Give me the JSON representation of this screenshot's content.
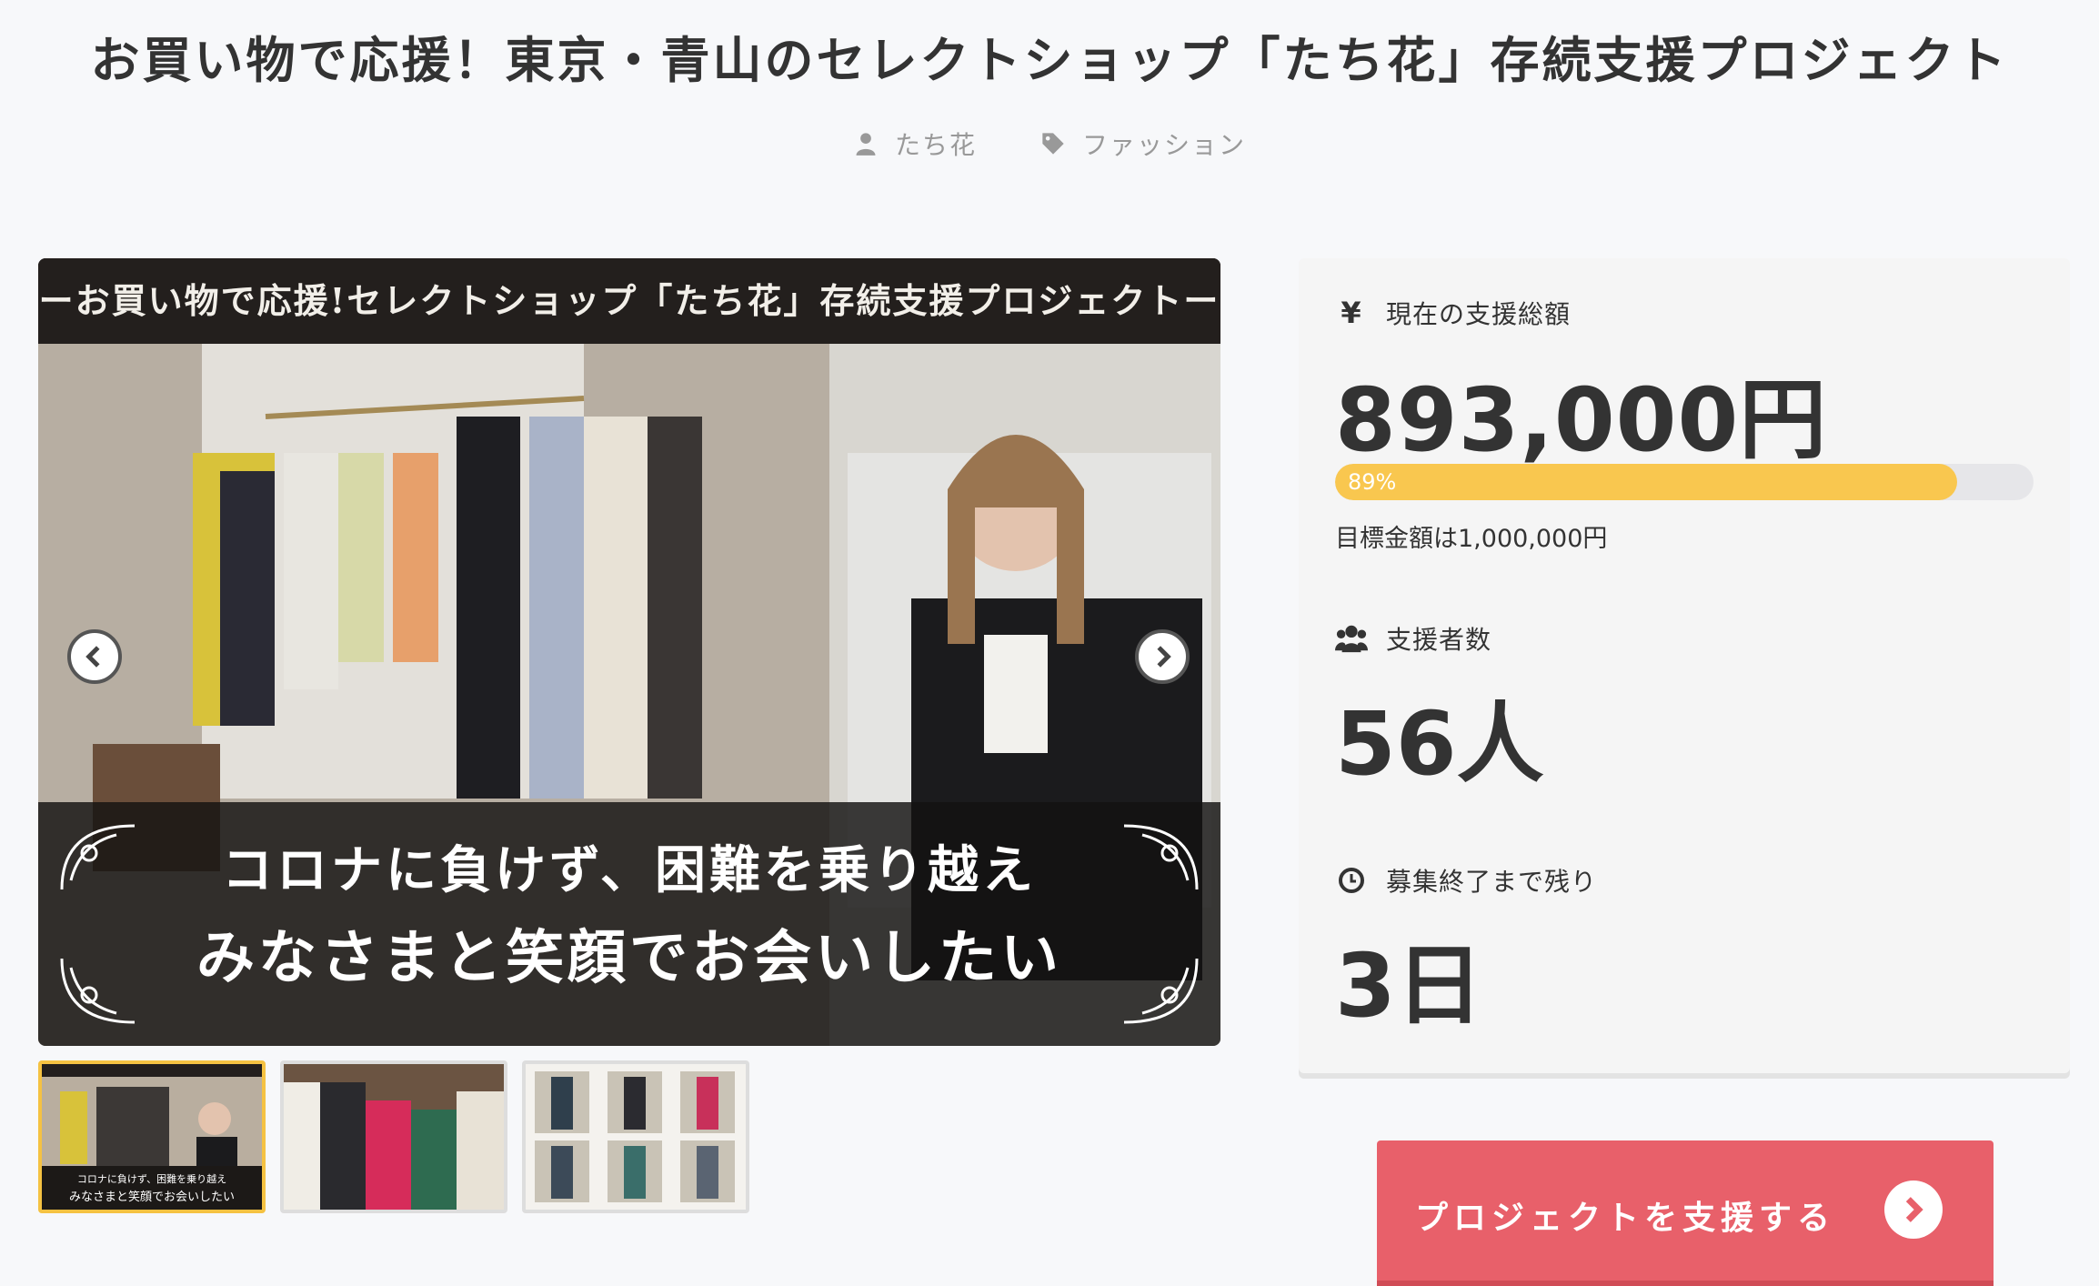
{
  "page": {
    "title": "お買い物で応援！東京・青山のセレクトショップ「たち花」存続支援プロジェクト"
  },
  "meta": {
    "owner": "たち花",
    "category": "ファッション",
    "icons": [
      "user-icon",
      "tag-icon"
    ]
  },
  "hero": {
    "banner_top": "ーお買い物で応援!セレクトショップ「たち花」存続支援プロジェクトー",
    "caption_line1": "コロナに負けず、困難を乗り越え",
    "caption_line2": "みなさまと笑顔でお会いしたい",
    "thumb1_line1": "コロナに負けず、困難を乗り越え",
    "thumb1_line2": "みなさまと笑顔でお会いしたい"
  },
  "stats": {
    "amount_label": "現在の支援総額",
    "amount_icon": "yen-icon",
    "amount": "893,000円",
    "progress_percent": 89,
    "progress_text": "89%",
    "goal_text": "目標金額は1,000,000円",
    "supporters_label": "支援者数",
    "supporters_icon": "users-icon",
    "supporters": "56人",
    "remaining_label": "募集終了まで残り",
    "remaining_icon": "clock-icon",
    "remaining": "3日"
  },
  "cta": {
    "label": "プロジェクトを支援する",
    "icon": "chevron-right-circle-icon"
  },
  "colors": {
    "progress": "#f9c74f",
    "cta": "#e8606a",
    "thumb_active": "#f5c242"
  }
}
